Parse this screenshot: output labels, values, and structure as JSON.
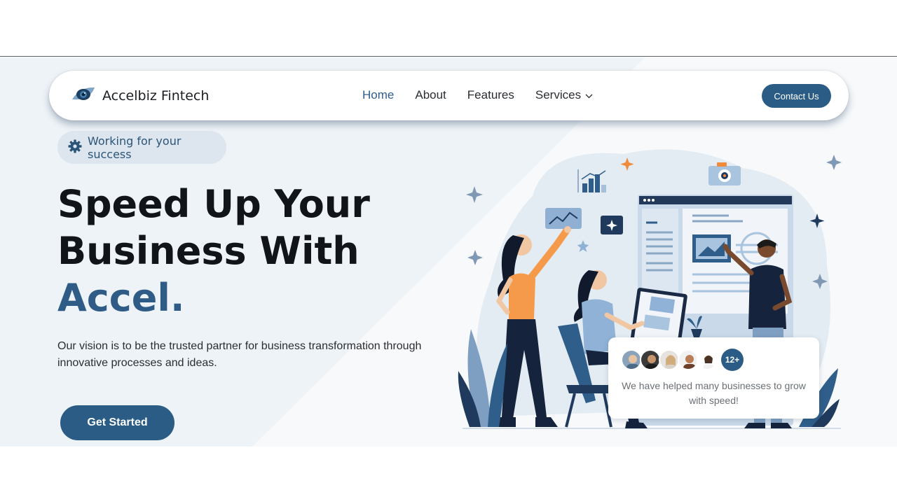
{
  "brand": {
    "name": "Accelbiz Fintech",
    "logo_icon": "eye-logo-icon"
  },
  "nav": {
    "items": [
      {
        "label": "Home",
        "active": true
      },
      {
        "label": "About",
        "active": false
      },
      {
        "label": "Features",
        "active": false
      },
      {
        "label": "Services",
        "active": false,
        "has_dropdown": true
      }
    ],
    "contact_label": "Contact Us"
  },
  "hero": {
    "badge_label": "Working for your success",
    "badge_icon": "gear-icon",
    "headline_line1": "Speed Up Your",
    "headline_line2": "Business With",
    "headline_accent": "Accel.",
    "description": "Our vision is to be the trusted partner for business transformation through innovative processes and ideas.",
    "cta_label": "Get Started"
  },
  "testimonial": {
    "count_label": "12+",
    "text": "We have helped many businesses to grow with speed!"
  },
  "colors": {
    "primary": "#2b5c85",
    "accent_text": "#2e5c86",
    "hero_bg": "#eef3f7",
    "illustration_orange": "#f59a4a"
  }
}
